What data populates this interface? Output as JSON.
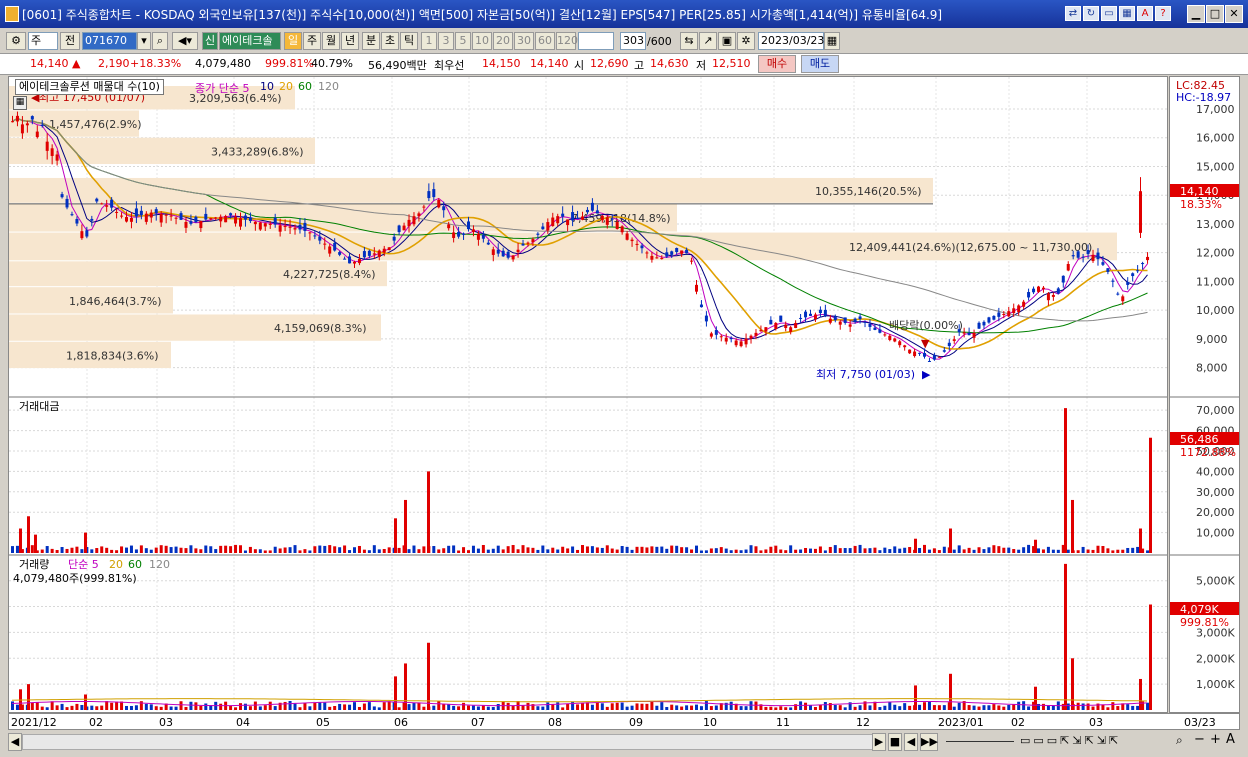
{
  "window": {
    "title": "[0601] 주식종합차트 - KOSDAQ 외국인보유[137(천)] 주식수[10,000(천)] 액면[500] 자본금[50(억)] 결산[12월] EPS[547] PER[25.85] 시가총액[1,414(억)] 유통비율[64.9]"
  },
  "toolbar": {
    "period_select": "주",
    "prev_label": "전",
    "code": "071670",
    "stock_badge": "신",
    "stock_name": "에이테크솔",
    "units": [
      "일",
      "주",
      "월",
      "년",
      "분",
      "초",
      "틱"
    ],
    "selected_unit": "일",
    "intervals": [
      "1",
      "3",
      "5",
      "10",
      "20",
      "30",
      "60",
      "120"
    ],
    "count": "303",
    "count_max": "/600",
    "date": "2023/03/23"
  },
  "quote": {
    "price": "14,140",
    "change": "2,190",
    "change_pct": "+18.33%",
    "volume": "4,079,480",
    "vol_ratio": "999.81%",
    "turnover": "40.79%",
    "amount": "56,490백만",
    "best_label": "최우선",
    "best_ask": "14,150",
    "best_bid": "14,140",
    "open_label": "시",
    "open": "12,690",
    "high_label": "고",
    "high": "14,630",
    "low_label": "저",
    "low": "12,510",
    "buy_label": "매수",
    "sell_label": "매도"
  },
  "price_panel": {
    "legend_box": "에이테크솔루션 매물대 수(10)",
    "ma_legend": "종가 단순 5",
    "ma_periods": [
      "10",
      "20",
      "60",
      "120"
    ],
    "high_marker": "최고 17,450 (01/07)",
    "low_marker": "최저 7,750 (01/03)",
    "dividend": "배당락(0.00%)",
    "lc": "LC:82.45",
    "hc": "HC:-18.97",
    "current": "14,140",
    "current_pct": "18.33%",
    "volume_profile": [
      "3,209,563(6.4%)",
      "1,457,476(2.9%)",
      "3,433,289(6.8%)",
      "10,355,146(20.5%)",
      "7,459,518(14.8%)",
      "12,409,441(24.6%)(12,675.00 ~ 11,730.00)",
      "4,227,725(8.4%)",
      "1,846,464(3.7%)",
      "4,159,069(8.3%)",
      "1,818,834(3.6%)"
    ]
  },
  "amount_panel": {
    "title": "거래대금",
    "current": "56,486",
    "current_pct": "1172.88%"
  },
  "volume_panel": {
    "title": "거래량",
    "ma_legend": "단순 5",
    "ma_periods": [
      "20",
      "60",
      "120"
    ],
    "value": "4,079,480주(999.81%)",
    "current": "4,079K",
    "current_pct": "999.81%"
  },
  "x_labels": [
    "2021/12",
    "02",
    "03",
    "04",
    "05",
    "06",
    "07",
    "08",
    "09",
    "10",
    "11",
    "12",
    "2023/01",
    "02",
    "03"
  ],
  "axis_end_label": "03/23",
  "chart_data": [
    {
      "type": "candlestick",
      "panel": "price",
      "y_ticks": [
        "17,000",
        "16,000",
        "15,000",
        "14,000",
        "13,000",
        "12,000",
        "11,000",
        "10,000",
        "9,000",
        "8,000"
      ],
      "ylim": [
        7500,
        17800
      ],
      "close_path": [
        [
          0,
          16500
        ],
        [
          8,
          16800
        ],
        [
          15,
          16200
        ],
        [
          20,
          17000
        ],
        [
          25,
          16000
        ],
        [
          30,
          16600
        ],
        [
          40,
          15500
        ],
        [
          45,
          15900
        ],
        [
          52,
          13800
        ],
        [
          60,
          13400
        ],
        [
          70,
          12800
        ],
        [
          78,
          12500
        ],
        [
          85,
          13800
        ],
        [
          100,
          13600
        ],
        [
          110,
          13300
        ],
        [
          120,
          13200
        ],
        [
          140,
          13400
        ],
        [
          160,
          13300
        ],
        [
          180,
          13000
        ],
        [
          200,
          13200
        ],
        [
          220,
          13300
        ],
        [
          240,
          13100
        ],
        [
          260,
          13000
        ],
        [
          280,
          12900
        ],
        [
          300,
          12700
        ],
        [
          310,
          12400
        ],
        [
          320,
          12200
        ],
        [
          330,
          11900
        ],
        [
          340,
          11600
        ],
        [
          350,
          11800
        ],
        [
          360,
          11900
        ],
        [
          370,
          12100
        ],
        [
          380,
          12200
        ],
        [
          390,
          12800
        ],
        [
          400,
          13200
        ],
        [
          410,
          13400
        ],
        [
          420,
          14000
        ],
        [
          430,
          13800
        ],
        [
          440,
          12800
        ],
        [
          450,
          12500
        ],
        [
          460,
          12900
        ],
        [
          470,
          12600
        ],
        [
          480,
          12200
        ],
        [
          490,
          11900
        ],
        [
          500,
          11800
        ],
        [
          510,
          12200
        ],
        [
          520,
          12400
        ],
        [
          530,
          12700
        ],
        [
          540,
          13200
        ],
        [
          550,
          13300
        ],
        [
          560,
          13100
        ],
        [
          570,
          13200
        ],
        [
          580,
          13500
        ],
        [
          590,
          13300
        ],
        [
          600,
          13200
        ],
        [
          610,
          13000
        ],
        [
          620,
          12500
        ],
        [
          630,
          12200
        ],
        [
          640,
          11900
        ],
        [
          650,
          11800
        ],
        [
          660,
          11900
        ],
        [
          670,
          12100
        ],
        [
          680,
          11900
        ],
        [
          690,
          10200
        ],
        [
          700,
          9200
        ],
        [
          710,
          9100
        ],
        [
          720,
          9000
        ],
        [
          730,
          8900
        ],
        [
          740,
          9100
        ],
        [
          750,
          9300
        ],
        [
          760,
          9500
        ],
        [
          770,
          9600
        ],
        [
          780,
          9400
        ],
        [
          790,
          9700
        ],
        [
          800,
          9800
        ],
        [
          810,
          9900
        ],
        [
          820,
          9700
        ],
        [
          830,
          9600
        ],
        [
          840,
          9500
        ],
        [
          850,
          9700
        ],
        [
          860,
          9400
        ],
        [
          870,
          9200
        ],
        [
          880,
          9100
        ],
        [
          890,
          8900
        ],
        [
          900,
          8600
        ],
        [
          910,
          8500
        ],
        [
          920,
          8200
        ],
        [
          930,
          8400
        ],
        [
          940,
          8800
        ],
        [
          950,
          9300
        ],
        [
          960,
          9100
        ],
        [
          970,
          9400
        ],
        [
          980,
          9600
        ],
        [
          990,
          9800
        ],
        [
          1000,
          10000
        ],
        [
          1010,
          10200
        ],
        [
          1020,
          10500
        ],
        [
          1030,
          10900
        ],
        [
          1040,
          10500
        ],
        [
          1050,
          10600
        ],
        [
          1060,
          11900
        ],
        [
          1070,
          11800
        ],
        [
          1080,
          12000
        ],
        [
          1090,
          11700
        ],
        [
          1100,
          11200
        ],
        [
          1110,
          10300
        ],
        [
          1120,
          11100
        ],
        [
          1130,
          11500
        ],
        [
          1140,
          12000
        ]
      ],
      "last_candle": {
        "open": 12690,
        "high": 14630,
        "low": 12510,
        "close": 14140
      }
    },
    {
      "type": "bar",
      "panel": "trading_amount",
      "y_ticks": [
        "70,000",
        "60,000",
        "50,000",
        "40,000",
        "30,000",
        "20,000",
        "10,000"
      ],
      "ylim": [
        0,
        74000
      ],
      "spikes": [
        [
          10,
          12000
        ],
        [
          18,
          18000
        ],
        [
          25,
          9000
        ],
        [
          75,
          10000
        ],
        [
          385,
          17000
        ],
        [
          395,
          26000
        ],
        [
          418,
          40000
        ],
        [
          905,
          7000
        ],
        [
          940,
          12000
        ],
        [
          1025,
          6500
        ],
        [
          1055,
          71000
        ],
        [
          1062,
          26000
        ],
        [
          1130,
          12000
        ],
        [
          1140,
          56486
        ]
      ]
    },
    {
      "type": "bar",
      "panel": "volume",
      "y_ticks": [
        "5,000K",
        "4,000K",
        "3,000K",
        "2,000K",
        "1,000K"
      ],
      "ylim": [
        0,
        5800
      ],
      "spikes": [
        [
          10,
          800
        ],
        [
          18,
          1000
        ],
        [
          75,
          600
        ],
        [
          385,
          1300
        ],
        [
          395,
          1800
        ],
        [
          418,
          2600
        ],
        [
          905,
          950
        ],
        [
          940,
          1400
        ],
        [
          1025,
          900
        ],
        [
          1055,
          5650
        ],
        [
          1062,
          2000
        ],
        [
          1130,
          1200
        ],
        [
          1140,
          4079
        ]
      ]
    }
  ]
}
